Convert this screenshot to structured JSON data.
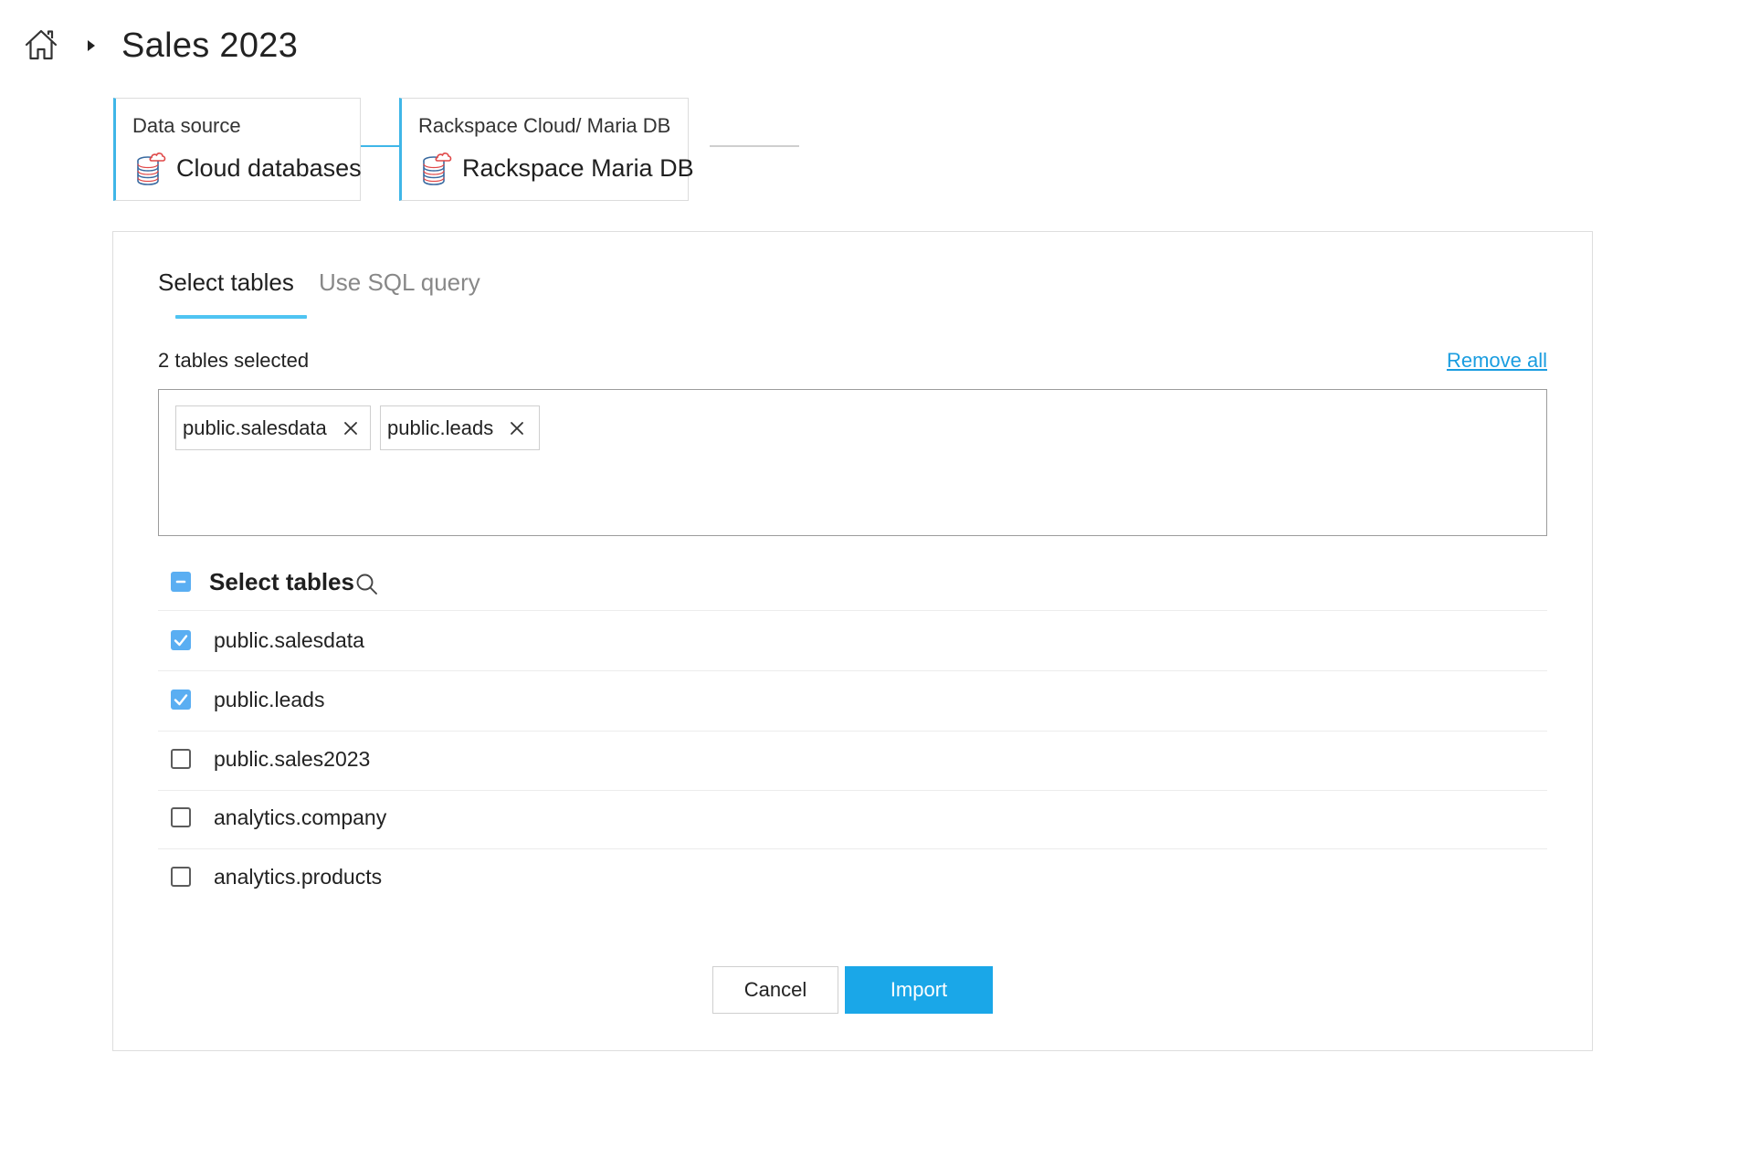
{
  "breadcrumb": {
    "home_icon": "home-icon",
    "separator_icon": "caret-right-icon",
    "title": "Sales 2023"
  },
  "steps": [
    {
      "label": "Data source",
      "value": "Cloud databases",
      "icon": "cloud-database-icon"
    },
    {
      "label": "Rackspace Cloud/ Maria DB",
      "value": "Rackspace Maria DB",
      "icon": "cloud-database-icon"
    }
  ],
  "tabs": [
    {
      "label": "Select tables",
      "active": true
    },
    {
      "label": "Use SQL query",
      "active": false
    }
  ],
  "selection": {
    "count_text": "2 tables selected",
    "remove_all": "Remove all",
    "chips": [
      "public.salesdata",
      "public.leads"
    ]
  },
  "table_list": {
    "header": "Select tables",
    "header_state": "indeterminate",
    "rows": [
      {
        "name": "public.salesdata",
        "checked": true
      },
      {
        "name": "public.leads",
        "checked": true
      },
      {
        "name": "public.sales2023",
        "checked": false
      },
      {
        "name": "analytics.company",
        "checked": false
      },
      {
        "name": "analytics.products",
        "checked": false
      }
    ]
  },
  "actions": {
    "cancel": "Cancel",
    "import": "Import"
  },
  "colors": {
    "accent": "#1aa7e8",
    "tab_underline": "#4fc4f2",
    "step_border": "#3fb6e8",
    "link": "#1a9de0",
    "checkbox_checked": "#5aaef2",
    "cloud_icon": "#e04848"
  }
}
